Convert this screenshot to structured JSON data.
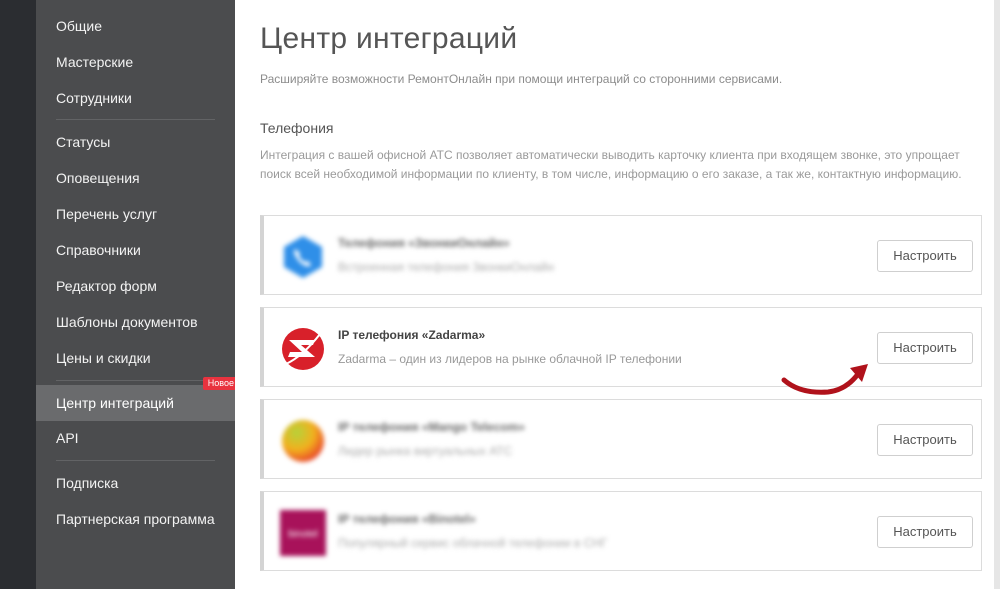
{
  "sidebar": {
    "items": [
      {
        "label": "Общие"
      },
      {
        "label": "Мастерские"
      },
      {
        "label": "Сотрудники"
      },
      {
        "label": "Статусы"
      },
      {
        "label": "Оповещения"
      },
      {
        "label": "Перечень услуг"
      },
      {
        "label": "Справочники"
      },
      {
        "label": "Редактор форм"
      },
      {
        "label": "Шаблоны документов"
      },
      {
        "label": "Цены и скидки"
      },
      {
        "label": "Центр интеграций",
        "active": true,
        "badge": "Новое"
      },
      {
        "label": "API"
      },
      {
        "label": "Подписка"
      },
      {
        "label": "Партнерская программа"
      }
    ]
  },
  "page": {
    "title": "Центр интеграций",
    "subtitle": "Расширяйте возможности РемонтОнлайн при помощи интеграций со сторонними сервисами."
  },
  "section": {
    "title": "Телефония",
    "description": "Интеграция с вашей офисной АТС позволяет автоматически выводить карточку клиента при входящем звонке, это упрощает поиск всей необходимой информации по клиенту, в том числе, информацию о его заказе, а так же, контактную информацию."
  },
  "integrations": [
    {
      "title": "Телефония «ЗвонкиОнлайн»",
      "description": "Встроенная телефония ЗвонкиОнлайн",
      "button": "Настроить",
      "icon": "phone-hex-icon",
      "blurred": true
    },
    {
      "title": "IP телефония «Zadarma»",
      "description": "Zadarma – один из лидеров на рынке облачной IP телефонии",
      "button": "Настроить",
      "icon": "zadarma-logo-icon",
      "blurred": false
    },
    {
      "title": "IP телефония «Mango Telecom»",
      "description": "Лидер рынка виртуальных АТС",
      "button": "Настроить",
      "icon": "mango-logo-icon",
      "blurred": true
    },
    {
      "title": "IP телефония «Binotel»",
      "description": "Популярный сервис облачной телефонии в СНГ",
      "button": "Настроить",
      "icon": "binotel-logo-icon",
      "logo_text": "binotel",
      "blurred": true
    }
  ],
  "colors": {
    "sidebar_bg": "#4b4c4e",
    "sidebar_active": "#6a6b6d",
    "badge": "#e8333f",
    "arrow": "#b0121b",
    "zadarma_red": "#d8202a"
  }
}
